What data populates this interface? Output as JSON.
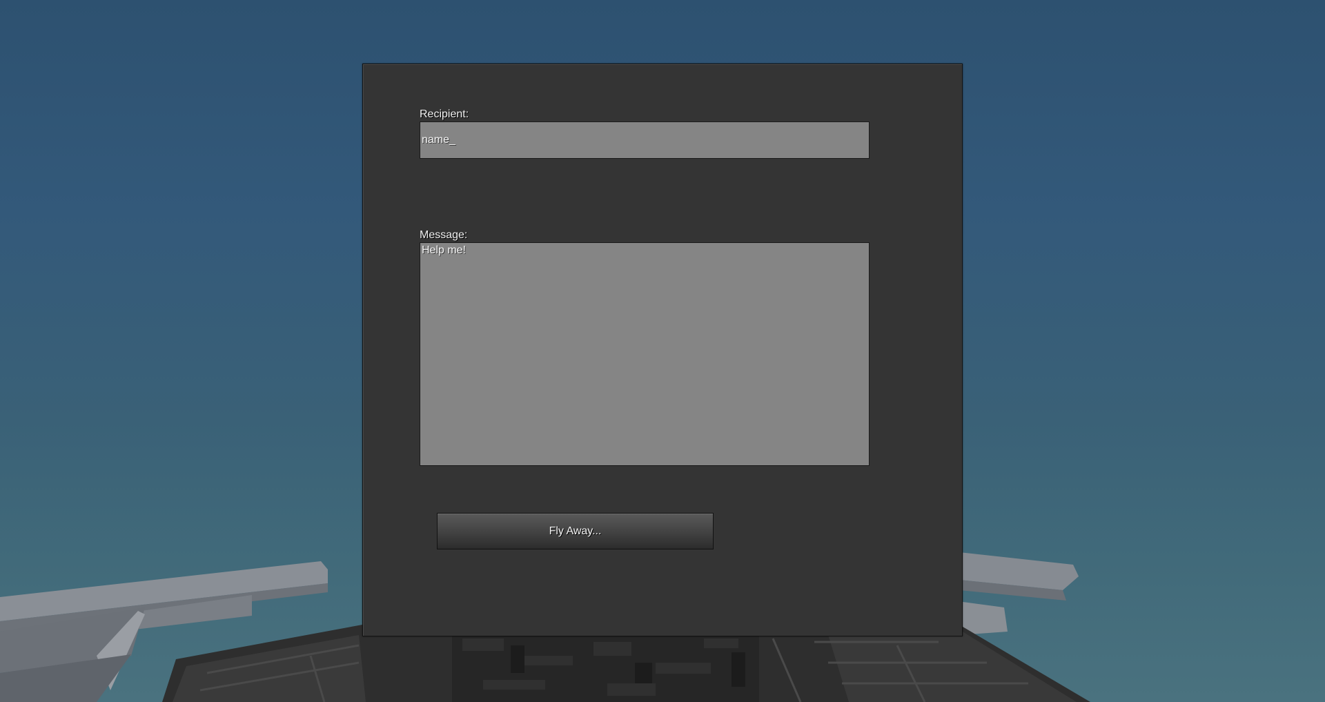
{
  "dialog": {
    "recipient_label": "Recipient:",
    "recipient_value": "name_",
    "message_label": "Message:",
    "message_value": "Help me!",
    "send_button_label": "Fly Away..."
  },
  "colors": {
    "sky": "#2d5170",
    "panel": "#343434",
    "field": "#858585",
    "text": "#f2f2f2"
  }
}
